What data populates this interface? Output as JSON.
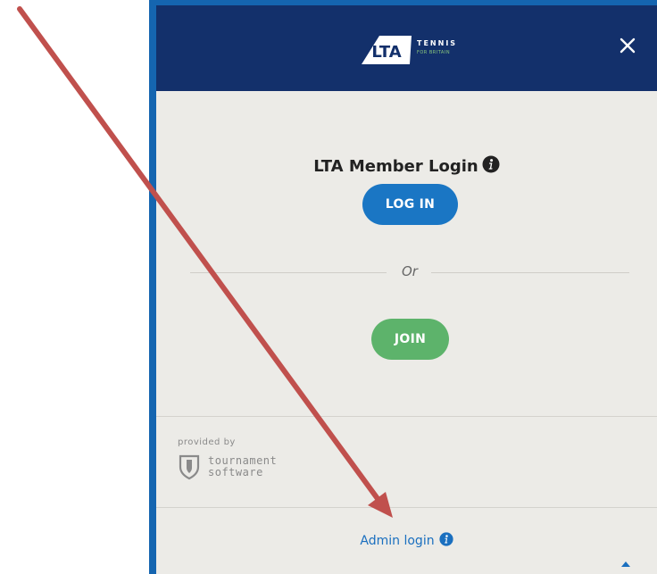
{
  "header": {
    "logo_mark": "LTA",
    "logo_word": "TENNIS",
    "logo_sub": "FOR BRITAIN",
    "close_icon": "close-icon",
    "bg_color": "#13306b"
  },
  "login": {
    "title": "LTA Member Login",
    "info_icon": "info-icon",
    "login_label": "LOG IN",
    "or_label": "Or",
    "join_label": "JOIN"
  },
  "footer": {
    "provided_by": "provided by",
    "provider_line1": "tournament",
    "provider_line2": "software",
    "provider_icon": "shield-icon",
    "admin_label": "Admin login",
    "caret_icon": "caret-up-icon"
  },
  "colors": {
    "frame": "#1565b0",
    "login_button": "#1a76c4",
    "join_button": "#5db36b",
    "annotation_arrow": "#c0504d"
  }
}
